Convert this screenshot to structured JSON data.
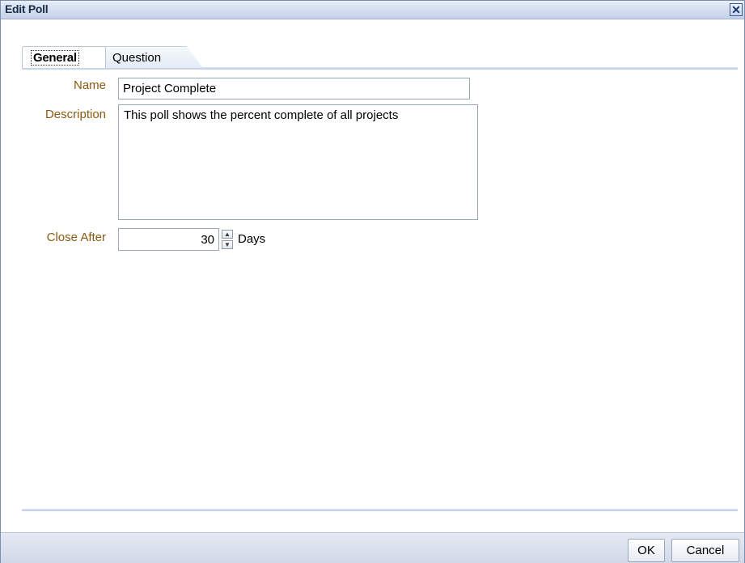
{
  "dialog": {
    "title": "Edit Poll",
    "close_icon": "close-icon",
    "close_glyph": "✕"
  },
  "tabs": [
    {
      "label": "General",
      "selected": true
    },
    {
      "label": "Question",
      "selected": false
    }
  ],
  "form": {
    "name_label": "Name",
    "name_value": "Project Complete",
    "description_label": "Description",
    "description_value": "This poll shows the percent complete of all projects",
    "close_after_label": "Close After",
    "close_after_value": "30",
    "close_after_unit": "Days",
    "spinner_up_icon": "chevron-up-icon",
    "spinner_down_icon": "chevron-down-icon"
  },
  "footer": {
    "ok_label": "OK",
    "cancel_label": "Cancel"
  },
  "colors": {
    "label_color": "#8a5a12",
    "titlebar": "#d3ddee",
    "footer": "#d1d9e8"
  }
}
